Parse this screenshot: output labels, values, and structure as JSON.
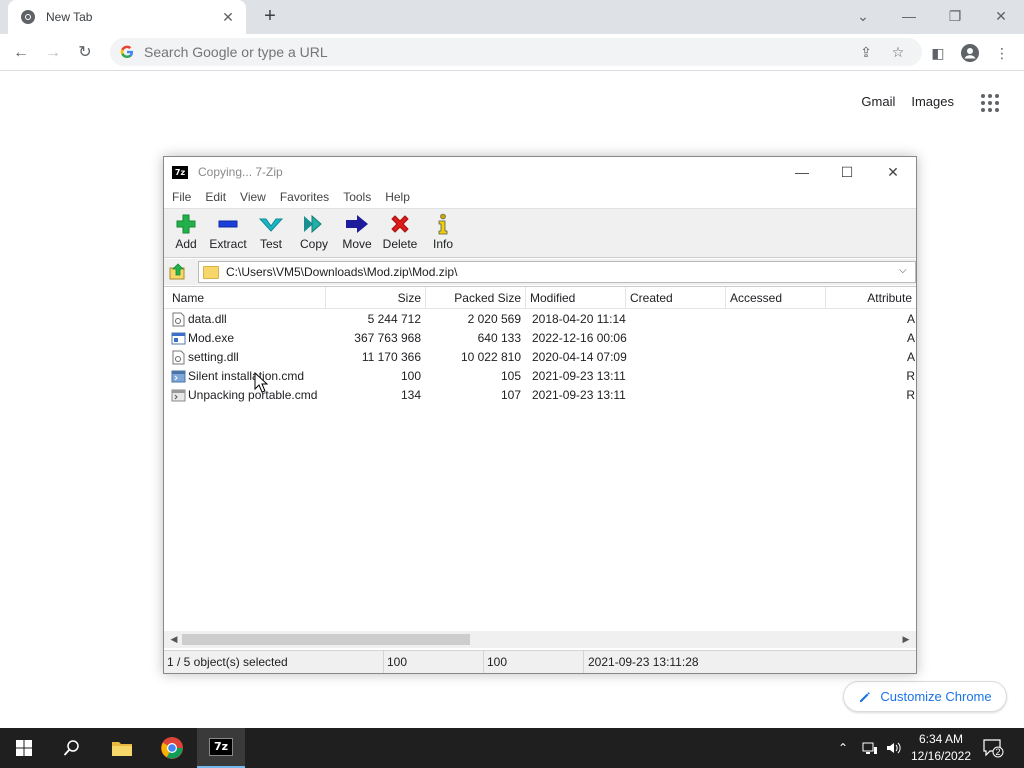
{
  "browser": {
    "tab_title": "New Tab",
    "new_tab_symbol": "+",
    "omnibox_placeholder": "Search Google or type a URL",
    "links": {
      "gmail": "Gmail",
      "images": "Images"
    },
    "customize_label": "Customize Chrome",
    "icons": [
      "chrome-icon",
      "back-icon",
      "forward-icon",
      "reload-icon",
      "google-icon",
      "share-icon",
      "bookmark-star-icon",
      "side-panel-icon",
      "profile-icon",
      "menu-icon",
      "apps-grid-icon",
      "pencil-icon"
    ]
  },
  "zip": {
    "logo": "7z",
    "title": "Copying... 7-Zip",
    "menu": [
      "File",
      "Edit",
      "View",
      "Favorites",
      "Tools",
      "Help"
    ],
    "toolbar": [
      {
        "label": "Add",
        "icon": "plus-icon",
        "color": "#22b14c"
      },
      {
        "label": "Extract",
        "icon": "minus-icon",
        "color": "#1c3ed8"
      },
      {
        "label": "Test",
        "icon": "check-icon",
        "color": "#19b6c5"
      },
      {
        "label": "Copy",
        "icon": "double-arrow-icon",
        "color": "#1a8f8f"
      },
      {
        "label": "Move",
        "icon": "arrow-right-icon",
        "color": "#1c1c9c"
      },
      {
        "label": "Delete",
        "icon": "x-icon",
        "color": "#e01a1a"
      },
      {
        "label": "Info",
        "icon": "info-icon",
        "color": "#c9a700"
      }
    ],
    "path": "C:\\Users\\VM5\\Downloads\\Mod.zip\\Mod.zip\\",
    "columns": [
      "Name",
      "Size",
      "Packed Size",
      "Modified",
      "Created",
      "Accessed",
      "Attribute"
    ],
    "files": [
      {
        "name": "data.dll",
        "size": "5 244 712",
        "packed": "2 020 569",
        "modified": "2018-04-20 11:14",
        "attr": "A",
        "icon": "dll-file-icon"
      },
      {
        "name": "Mod.exe",
        "size": "367 763 968",
        "packed": "640 133",
        "modified": "2022-12-16 00:06",
        "attr": "A",
        "icon": "exe-file-icon"
      },
      {
        "name": "setting.dll",
        "size": "11 170 366",
        "packed": "10 022 810",
        "modified": "2020-04-14 07:09",
        "attr": "A",
        "icon": "dll-file-icon"
      },
      {
        "name": "Silent installation.cmd",
        "size": "100",
        "packed": "105",
        "modified": "2021-09-23 13:11",
        "attr": "R",
        "icon": "cmd-file-icon",
        "selected": true
      },
      {
        "name": "Unpacking portable.cmd",
        "size": "134",
        "packed": "107",
        "modified": "2021-09-23 13:11",
        "attr": "R",
        "icon": "cmd-file-icon"
      }
    ],
    "status": {
      "selection": "1 / 5 object(s) selected",
      "size": "100",
      "packed": "100",
      "modified": "2021-09-23 13:11:28"
    }
  },
  "taskbar": {
    "time": "6:34 AM",
    "date": "12/16/2022",
    "notification_count": "2",
    "active_app": "7z"
  }
}
